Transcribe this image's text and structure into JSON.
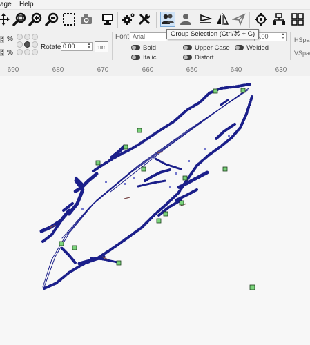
{
  "menu": {
    "items": [
      "age",
      "Help"
    ]
  },
  "toolbar": {
    "buttons": [
      "move-icon",
      "zoom-fit-icon",
      "zoom-in-icon",
      "zoom-out-icon",
      "frame-select-icon",
      "camera-icon",
      "monitor-icon",
      "settings-icon",
      "tools-icon",
      "group-selection-icon",
      "user-icon",
      "align-icon",
      "mirror-icon",
      "send-icon",
      "target-icon",
      "distribute-icon",
      "grid-icon"
    ]
  },
  "tooltip": {
    "text": "Group Selection (Ctrl/⌘ + G)"
  },
  "props": {
    "pct1": "%",
    "pct2": "%",
    "rotate_label": "Rotate",
    "rotate_value": "0.00",
    "mm_label": "mm",
    "font_label": "Font",
    "font_value": "Arial",
    "size_value": "5.00",
    "bold_label": "Bold",
    "italic_label": "Italic",
    "upper_case_label": "Upper Case",
    "distort_label": "Distort",
    "welded_label": "Welded",
    "hspace_label": "HSpac",
    "vspace_label": "VSpac"
  },
  "ruler": {
    "ticks": [
      "690",
      "680",
      "670",
      "660",
      "650",
      "640",
      "630"
    ]
  },
  "colors": {
    "accent": "#1b1f8a",
    "node_green": "#7bd47b",
    "tooltip_border": "#767676"
  }
}
